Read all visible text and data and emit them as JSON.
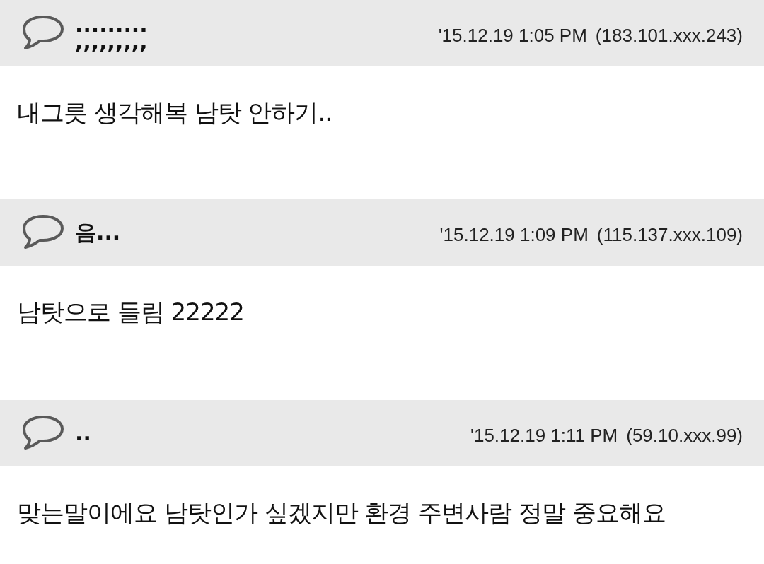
{
  "comments": [
    {
      "author": ".........\n,,,,,,,,,",
      "date": "'15.12.19 1:05 PM",
      "ip": "(183.101.xxx.243)",
      "text": "내그릇 생각해복 남탓 안하기.."
    },
    {
      "author": "음...",
      "date": "'15.12.19 1:09 PM",
      "ip": "(115.137.xxx.109)",
      "text": "남탓으로 들림 22222"
    },
    {
      "author": "..",
      "date": "'15.12.19 1:11 PM",
      "ip": "(59.10.xxx.99)",
      "text": "맞는말이에요 남탓인가 싶겠지만 환경 주변사람 정말 중요해요"
    }
  ]
}
